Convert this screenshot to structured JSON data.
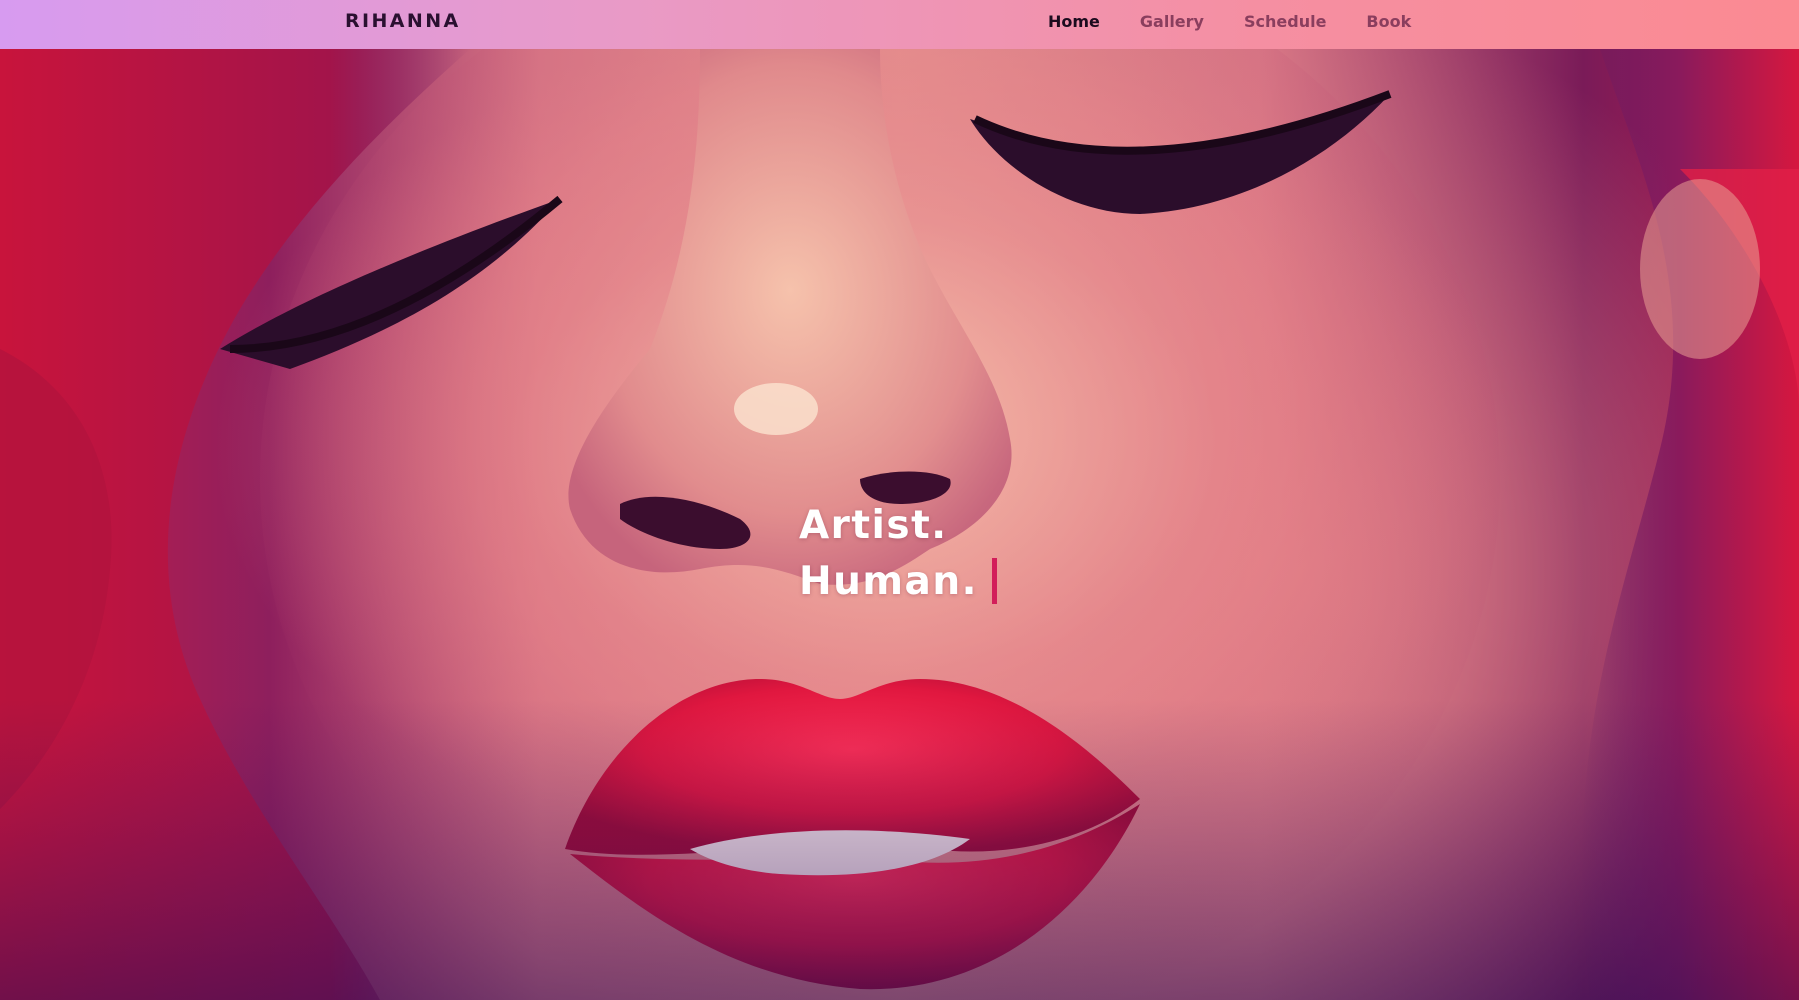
{
  "brand": {
    "name": "RIHANNA"
  },
  "nav": {
    "items": [
      {
        "label": "Home",
        "active": true
      },
      {
        "label": "Gallery",
        "active": false
      },
      {
        "label": "Schedule",
        "active": false
      },
      {
        "label": "Book",
        "active": false
      }
    ]
  },
  "hero": {
    "tagline_line1": "Artist.",
    "tagline_line2": "Human.",
    "cursor_color": "#d21e5a"
  },
  "colors": {
    "navbar_gradient_start": "#d79bf0",
    "navbar_gradient_end": "#fb8a92",
    "nav_active": "#1c0b1e",
    "nav_inactive": "#8a3e5e",
    "lips": "#e0173f",
    "hair": "#c8143c"
  }
}
